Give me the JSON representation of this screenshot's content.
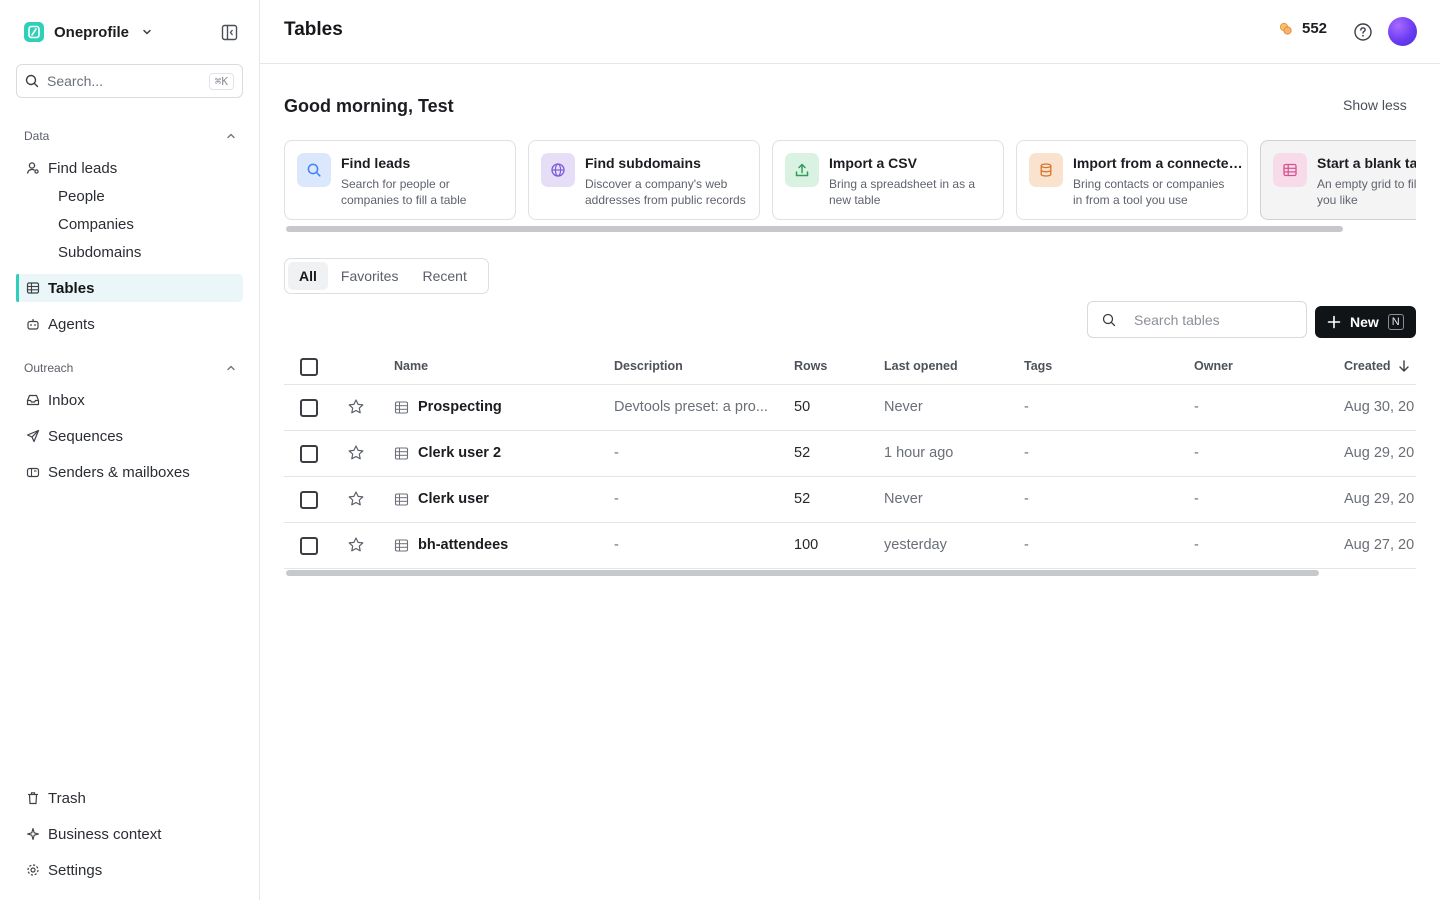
{
  "workspace": {
    "name": "Oneprofile"
  },
  "sidebar": {
    "search_placeholder": "Search...",
    "search_shortcut": "⌘K",
    "sections": {
      "data": "Data",
      "outreach": "Outreach"
    },
    "items": {
      "find_leads": "Find leads",
      "people": "People",
      "companies": "Companies",
      "subdomains": "Subdomains",
      "tables": "Tables",
      "agents": "Agents",
      "inbox": "Inbox",
      "sequences": "Sequences",
      "senders": "Senders & mailboxes",
      "trash": "Trash",
      "business_context": "Business context",
      "settings": "Settings"
    }
  },
  "header": {
    "title": "Tables",
    "credits": "552"
  },
  "main": {
    "greeting": "Good morning, Test",
    "show_less": "Show less",
    "cards": [
      {
        "title": "Find leads",
        "desc": "Search for people or companies to fill a table",
        "icon": "search-icon",
        "bg": "#dbe8fb",
        "fg": "#3b82f6"
      },
      {
        "title": "Find subdomains",
        "desc": "Discover a company's web addresses from public records",
        "icon": "globe-icon",
        "bg": "#e6def7",
        "fg": "#7c5cd6"
      },
      {
        "title": "Import a CSV",
        "desc": "Bring a spreadsheet in as a new table",
        "icon": "upload-icon",
        "bg": "#d9f2e2",
        "fg": "#2f9e5b"
      },
      {
        "title": "Import from a connected tool",
        "desc": "Bring contacts or companies in from a tool you use",
        "icon": "database-icon",
        "bg": "#f9e3cf",
        "fg": "#d9742a"
      },
      {
        "title": "Start a blank table",
        "desc": "An empty grid to fill however you like",
        "icon": "grid-icon",
        "bg": "#f8dbe8",
        "fg": "#d6518f"
      }
    ],
    "tabs": [
      "All",
      "Favorites",
      "Recent"
    ],
    "active_tab": "All",
    "table_search_placeholder": "Search tables",
    "new_button": {
      "label": "New",
      "shortcut": "N"
    }
  },
  "table": {
    "columns": {
      "name": "Name",
      "description": "Description",
      "rows": "Rows",
      "last_opened": "Last opened",
      "tags": "Tags",
      "owner": "Owner",
      "created": "Created"
    },
    "rows": [
      {
        "name": "Prospecting",
        "description": "Devtools preset: a pro...",
        "rows": "50",
        "last_opened": "Never",
        "tags": "-",
        "owner": "-",
        "created": "Aug 30, 20"
      },
      {
        "name": "Clerk user 2",
        "description": "-",
        "rows": "52",
        "last_opened": "1 hour ago",
        "tags": "-",
        "owner": "-",
        "created": "Aug 29, 20"
      },
      {
        "name": "Clerk user",
        "description": "-",
        "rows": "52",
        "last_opened": "Never",
        "tags": "-",
        "owner": "-",
        "created": "Aug 29, 20"
      },
      {
        "name": "bh-attendees",
        "description": "-",
        "rows": "100",
        "last_opened": "yesterday",
        "tags": "-",
        "owner": "-",
        "created": "Aug 27, 20"
      }
    ]
  },
  "colors": {
    "accent": "#2fcfb9",
    "active_bg": "#eaf6f7",
    "primary_button": "#111417"
  }
}
